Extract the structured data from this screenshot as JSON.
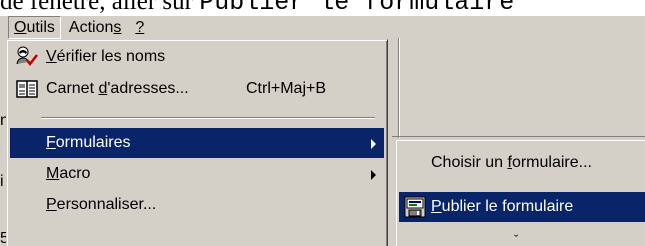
{
  "caption": {
    "prefix": "de fenêtre, aller sur ",
    "code": "Publier le formulaire"
  },
  "window_fragments": [
    "n",
    "i",
    "5"
  ],
  "menubar": {
    "items": [
      {
        "label_u": "O",
        "label_rest": "utils",
        "active": true
      },
      {
        "label_pre": "Action",
        "label_u": "s",
        "active": false
      },
      {
        "label_u": "?",
        "active": false
      }
    ]
  },
  "tools_menu": {
    "items": [
      {
        "icon": "check-names-icon",
        "label_u": "V",
        "label_rest": "érifier les noms",
        "shortcut": ""
      },
      {
        "icon": "address-book-icon",
        "label_pre": "Carnet ",
        "label_u": "d",
        "label_rest": "'adresses...",
        "shortcut": "Ctrl+Maj+B"
      },
      {
        "icon": "",
        "label_u": "F",
        "label_rest": "ormulaires",
        "submenu": true,
        "highlighted": true
      },
      {
        "icon": "",
        "label_u": "M",
        "label_rest": "acro",
        "submenu": true
      },
      {
        "icon": "",
        "label_u": "P",
        "label_rest": "ersonnaliser..."
      }
    ]
  },
  "forms_submenu": {
    "items": [
      {
        "icon": "",
        "label_pre": "Choisir un ",
        "label_u": "f",
        "label_rest": "ormulaire..."
      },
      {
        "icon": "publish-form-icon",
        "label_u": "P",
        "label_rest": "ublier le formulaire",
        "highlighted": true
      }
    ],
    "more_glyph": "ˇ"
  },
  "colors": {
    "menu_bg": "#d4d0c8",
    "highlight": "#0a246a",
    "highlight_text": "#ffffff"
  }
}
